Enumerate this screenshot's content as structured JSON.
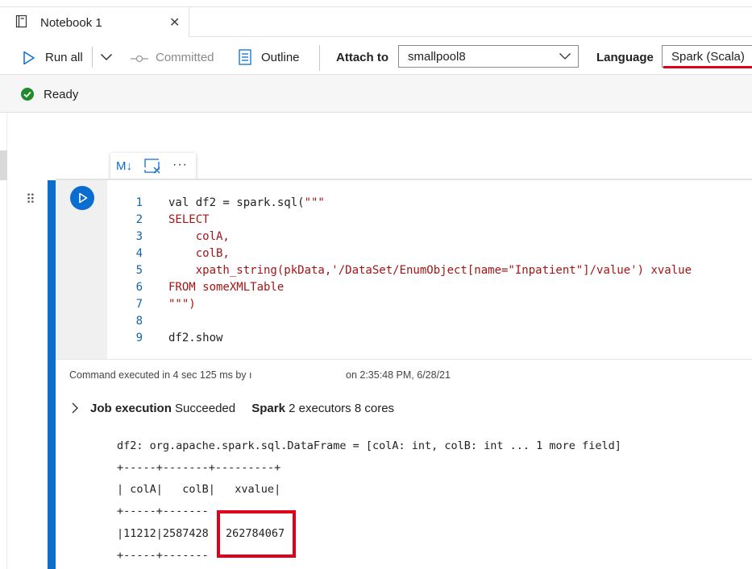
{
  "tab": {
    "title": "Notebook 1",
    "close": "✕"
  },
  "toolbar": {
    "run_all": "Run all",
    "committed": "Committed",
    "outline": "Outline",
    "attach_label": "Attach to",
    "attach_value": "smallpool8",
    "language_label": "Language",
    "language_value": "Spark (Scala)"
  },
  "status": {
    "text": "Ready"
  },
  "cell_toolbar": {
    "markdown": "M↓",
    "more": "···"
  },
  "cell": {
    "line_numbers": [
      "1",
      "2",
      "3",
      "4",
      "5",
      "6",
      "7",
      "8",
      "9"
    ],
    "code": {
      "l1_a": "val df2 = spark.sql(",
      "l1_b": "\"\"\"",
      "l2": "SELECT",
      "l3": "    colA,",
      "l4": "    colB,",
      "l5": "    xpath_string(pkData,'/DataSet/EnumObject[name=\"Inpatient\"]/value') xvalue",
      "l6": "FROM someXMLTable",
      "l7": "\"\"\")",
      "l8": "",
      "l9": "df2.show"
    }
  },
  "output": {
    "exec_info": "Command executed in 4 sec 125 ms by ı",
    "exec_time": "on 2:35:48 PM, 6/28/21",
    "job_label": "Job execution",
    "job_status": "Succeeded",
    "spark_label": "Spark",
    "spark_info": "2 executors 8 cores",
    "lines": [
      "df2: org.apache.spark.sql.DataFrame = [colA: int, colB: int ... 1 more field]",
      "+-----+-------+---------+",
      "| colA|   colB|   xvalue|",
      "+-----+-------",
      "|11212|2587428",
      "+-----+-------"
    ],
    "highlighted_value": "262784067"
  },
  "colors": {
    "accent": "#0a6ed1",
    "highlight": "#e0001a",
    "ready": "#1f8a2c"
  }
}
